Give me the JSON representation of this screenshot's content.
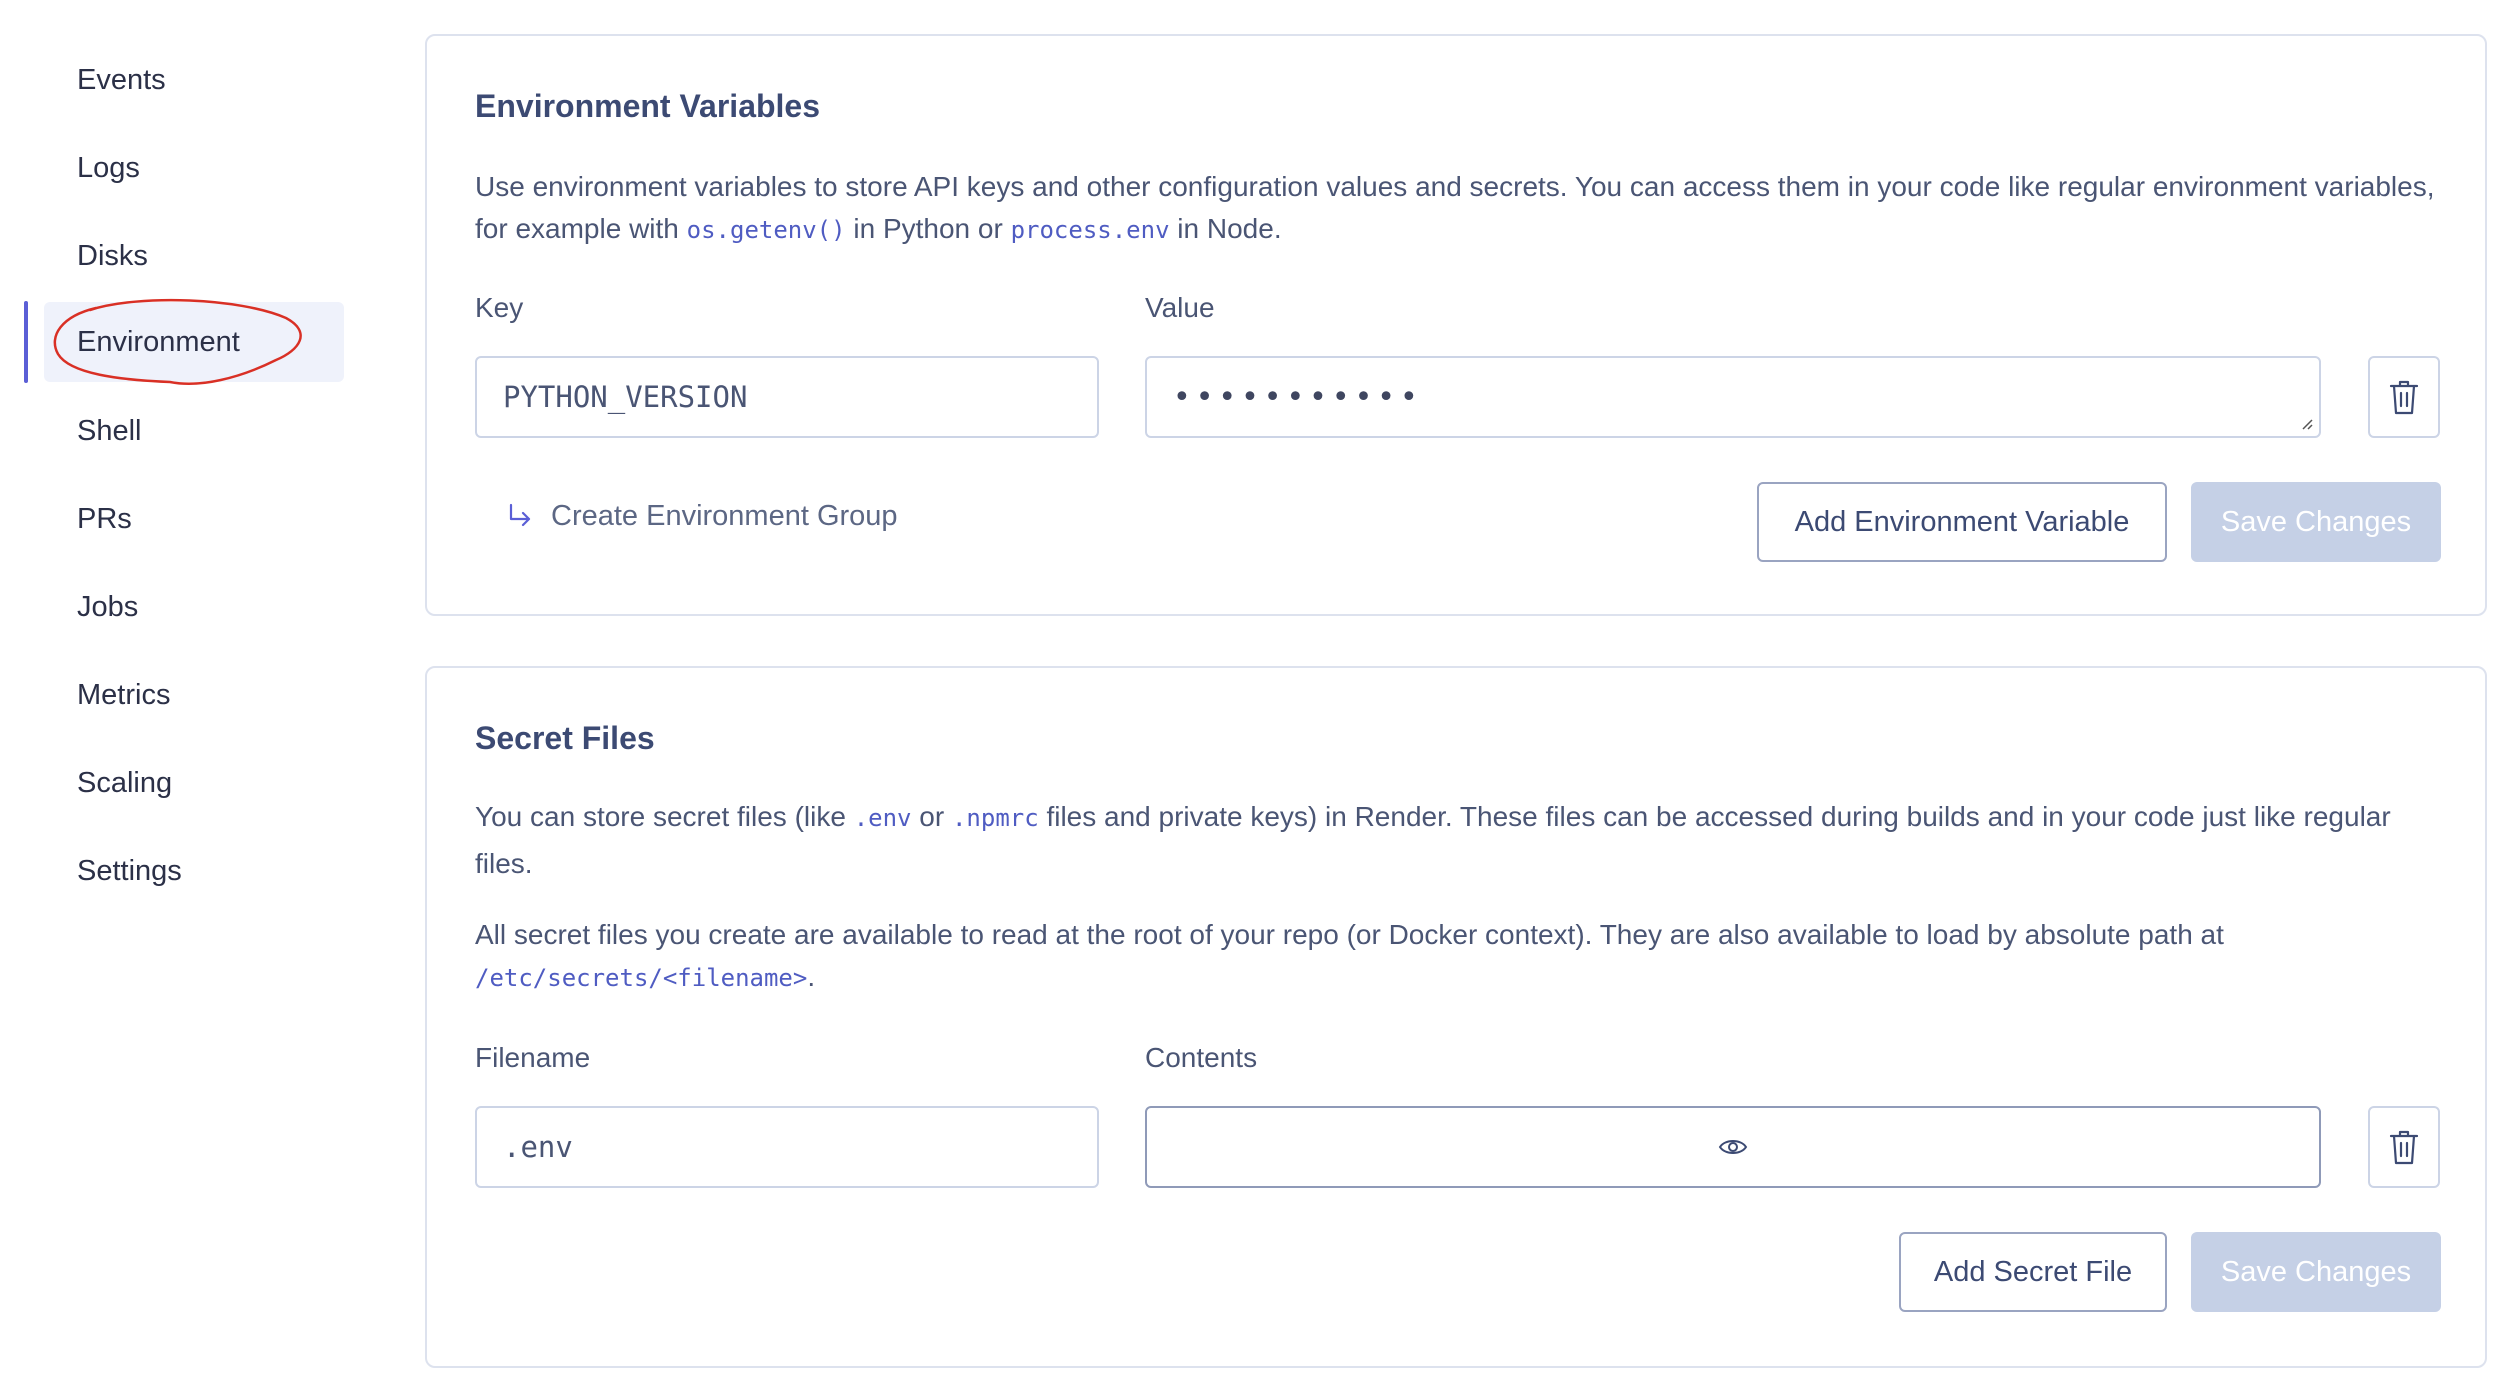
{
  "sidebar": {
    "items": [
      {
        "label": "Events"
      },
      {
        "label": "Logs"
      },
      {
        "label": "Disks"
      },
      {
        "label": "Environment"
      },
      {
        "label": "Shell"
      },
      {
        "label": "PRs"
      },
      {
        "label": "Jobs"
      },
      {
        "label": "Metrics"
      },
      {
        "label": "Scaling"
      },
      {
        "label": "Settings"
      }
    ],
    "active": "Environment"
  },
  "env_vars": {
    "title": "Environment Variables",
    "desc_part1": "Use environment variables to store API keys and other configuration values and secrets. You can access them in your code like regular environment variables, for example with ",
    "code1": "os.getenv()",
    "desc_part2": " in Python or ",
    "code2": "process.env",
    "desc_part3": " in Node.",
    "key_label": "Key",
    "value_label": "Value",
    "key_value": "PYTHON_VERSION",
    "value_masked": "•••••••••••",
    "create_group": "Create Environment Group",
    "add_button": "Add Environment Variable",
    "save_button": "Save Changes"
  },
  "secret_files": {
    "title": "Secret Files",
    "desc1_part1": "You can store secret files (like ",
    "desc1_code1": ".env",
    "desc1_part2": " or ",
    "desc1_code2": ".npmrc",
    "desc1_part3": " files and private keys) in Render. These files can be accessed during builds and in your code just like regular files.",
    "desc2_part1": "All secret files you create are available to read at the root of your repo (or Docker context). They are also available to load by absolute path at ",
    "desc2_code": "/etc/secrets/<filename>",
    "desc2_part2": ".",
    "filename_label": "Filename",
    "contents_label": "Contents",
    "filename_value": ".env",
    "add_button": "Add Secret File",
    "save_button": "Save Changes"
  },
  "colors": {
    "accent": "#5b5fd6",
    "annotation": "#d93025",
    "disabled_button": "#c5d0e6",
    "code_text": "#4f5cc2"
  },
  "icons": [
    "trash-icon",
    "eye-icon",
    "return-arrow-icon"
  ]
}
